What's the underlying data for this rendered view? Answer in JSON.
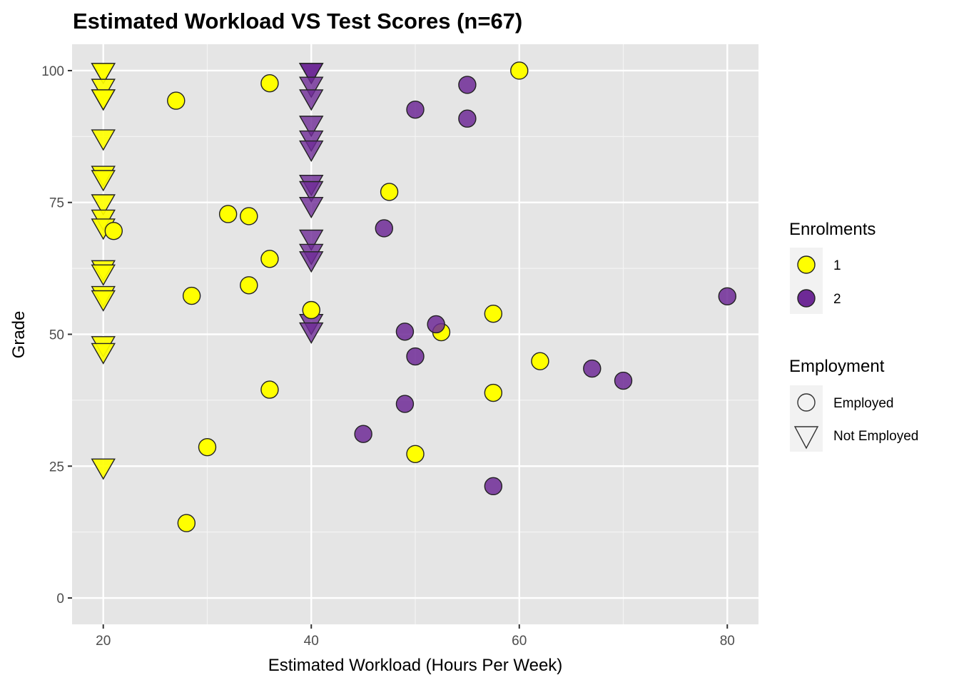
{
  "chart_data": {
    "type": "scatter",
    "title": "Estimated Workload VS Test Scores (n=67)",
    "xlabel": "Estimated Workload (Hours Per Week)",
    "ylabel": "Grade",
    "xlim": [
      17,
      83
    ],
    "ylim": [
      -5,
      105
    ],
    "xticks": [
      20,
      40,
      60,
      80
    ],
    "yticks": [
      0,
      25,
      50,
      75,
      100
    ],
    "x_minor_grid": [
      30,
      50,
      70
    ],
    "y_minor_grid": [
      12.5,
      37.5,
      62.5,
      87.5
    ],
    "grid": true,
    "panel_background": "#E5E5E5",
    "legend_position": "right",
    "legends": [
      {
        "title": "Enrolments",
        "aesthetic": "fill",
        "entries": [
          {
            "label": "1",
            "color": "#FFFF00"
          },
          {
            "label": "2",
            "color": "#6E2A96"
          }
        ]
      },
      {
        "title": "Employment",
        "aesthetic": "shape",
        "entries": [
          {
            "label": "Employed",
            "shape": "circle"
          },
          {
            "label": "Not Employed",
            "shape": "triangle-down"
          }
        ]
      }
    ],
    "series": [
      {
        "name": "Enrolments 1 / Not Employed",
        "enrolments": "1",
        "employment": "Not Employed",
        "color": "#FFFF00",
        "shape": "triangle-down",
        "points": [
          [
            20,
            100
          ],
          [
            20,
            100
          ],
          [
            20,
            97
          ],
          [
            20,
            95
          ],
          [
            20,
            95
          ],
          [
            20,
            87.4
          ],
          [
            20,
            80.5
          ],
          [
            20,
            79.7
          ],
          [
            20,
            75.1
          ],
          [
            20,
            72.2
          ],
          [
            20,
            70.5
          ],
          [
            20,
            62.6
          ],
          [
            20,
            61.8
          ],
          [
            20,
            57.7
          ],
          [
            20,
            56.9
          ],
          [
            20,
            48.2
          ],
          [
            20,
            46.9
          ],
          [
            20,
            25
          ]
        ]
      },
      {
        "name": "Enrolments 2 / Not Employed",
        "enrolments": "2",
        "employment": "Not Employed",
        "color": "#6E2A96",
        "shape": "triangle-down",
        "points": [
          [
            40,
            100
          ],
          [
            40,
            100
          ],
          [
            40,
            100
          ],
          [
            40,
            97.4
          ],
          [
            40,
            95
          ],
          [
            40,
            90
          ],
          [
            40,
            87.2
          ],
          [
            40,
            85.3
          ],
          [
            40,
            78.8
          ],
          [
            40,
            77.6
          ],
          [
            40,
            74.6
          ],
          [
            40,
            68.4
          ],
          [
            40,
            65.7
          ],
          [
            40,
            64.3
          ],
          [
            40,
            52.4
          ],
          [
            40,
            50.8
          ]
        ]
      },
      {
        "name": "Enrolments 1 / Employed",
        "enrolments": "1",
        "employment": "Employed",
        "color": "#FFFF00",
        "shape": "circle",
        "points": [
          [
            27,
            94.3
          ],
          [
            36,
            97.6
          ],
          [
            32,
            72.8
          ],
          [
            34,
            72.4
          ],
          [
            21,
            69.6
          ],
          [
            36,
            64.3
          ],
          [
            34,
            59.3
          ],
          [
            28.5,
            57.3
          ],
          [
            36,
            39.5
          ],
          [
            30,
            28.6
          ],
          [
            28,
            14.2
          ],
          [
            40,
            54.6
          ],
          [
            47.5,
            77.0
          ],
          [
            60,
            100
          ],
          [
            52.5,
            50.4
          ],
          [
            57.5,
            53.9
          ],
          [
            62,
            44.9
          ],
          [
            57.5,
            38.9
          ],
          [
            50,
            27.3
          ]
        ]
      },
      {
        "name": "Enrolments 2 / Employed",
        "enrolments": "2",
        "employment": "Employed",
        "color": "#6E2A96",
        "shape": "circle",
        "points": [
          [
            55,
            97.3
          ],
          [
            50,
            92.6
          ],
          [
            55,
            90.9
          ],
          [
            47,
            70.1
          ],
          [
            49,
            50.5
          ],
          [
            52,
            51.9
          ],
          [
            50,
            45.8
          ],
          [
            49,
            36.8
          ],
          [
            45,
            31.1
          ],
          [
            57.5,
            21.2
          ],
          [
            80,
            57.2
          ],
          [
            67,
            43.5
          ],
          [
            70,
            41.2
          ]
        ]
      }
    ]
  }
}
